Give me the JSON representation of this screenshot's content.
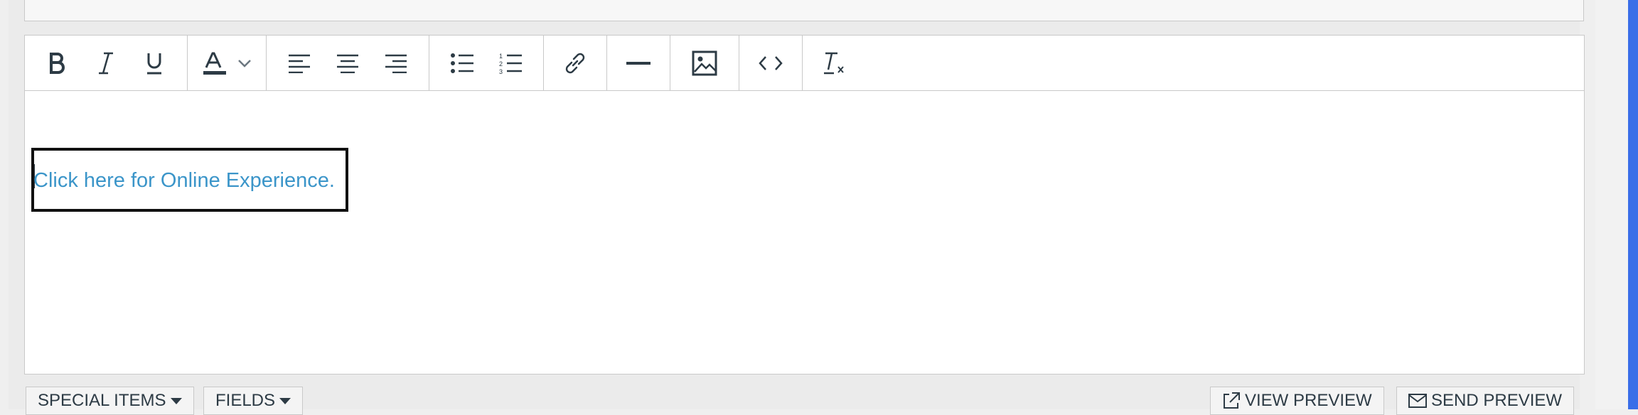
{
  "editor": {
    "link_text": "Click here for Online Experience."
  },
  "toolbar": {
    "groups": [
      [
        "bold-icon",
        "italic-icon",
        "underline-icon"
      ],
      [
        "text-color-icon"
      ],
      [
        "align-left-icon",
        "align-center-icon",
        "align-right-icon"
      ],
      [
        "bullet-list-icon",
        "numbered-list-icon"
      ],
      [
        "link-icon"
      ],
      [
        "horizontal-rule-icon"
      ],
      [
        "image-icon"
      ],
      [
        "html-code-icon"
      ],
      [
        "clear-formatting-icon"
      ]
    ]
  },
  "footer": {
    "special_items": "SPECIAL ITEMS",
    "fields": "FIELDS",
    "view_preview": "VIEW PREVIEW",
    "send_preview": "SEND PREVIEW"
  },
  "colors": {
    "link": "#3b95c9",
    "icon": "#2d3b45",
    "scrollbar": "#3a6ee8"
  }
}
